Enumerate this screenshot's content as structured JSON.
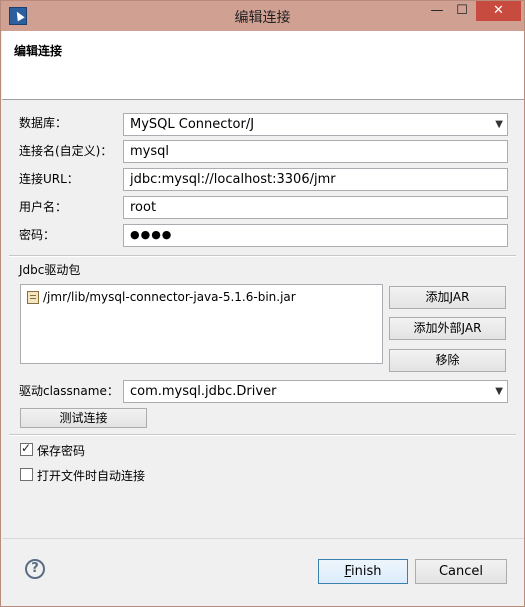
{
  "window": {
    "title": "编辑连接",
    "minimize_glyph": "—",
    "maximize_glyph": "☐",
    "close_glyph": "✕"
  },
  "banner": {
    "title": "编辑连接"
  },
  "form": {
    "database_label": "数据库：",
    "database_value": "MySQL Connector/J",
    "conn_name_label": "连接名(自定义)：",
    "conn_name_value": "mysql",
    "url_label": "连接URL：",
    "url_value": "jdbc:mysql://localhost:3306/jmr",
    "username_label": "用户名：",
    "username_value": "root",
    "password_label": "密码：",
    "password_value": "●●●●"
  },
  "driver": {
    "section_label": "Jdbc驱动包",
    "jar_items": [
      "/jmr/lib/mysql-connector-java-5.1.6-bin.jar"
    ],
    "add_jar_label": "添加JAR",
    "add_external_jar_label": "添加外部JAR",
    "remove_label": "移除",
    "classname_label": "驱动classname：",
    "classname_value": "com.mysql.jdbc.Driver",
    "test_connection_label": "测试连接"
  },
  "options": {
    "save_password_label": "保存密码",
    "save_password_checked": true,
    "auto_connect_label": "打开文件时自动连接",
    "auto_connect_checked": false
  },
  "footer": {
    "help_glyph": "?",
    "finish_label": "Finish",
    "cancel_label": "Cancel"
  },
  "icons": {
    "app": "cursor-arrow-icon",
    "jar": "jar-file-icon",
    "help": "help-icon",
    "dropdown": "chevron-down-icon"
  }
}
